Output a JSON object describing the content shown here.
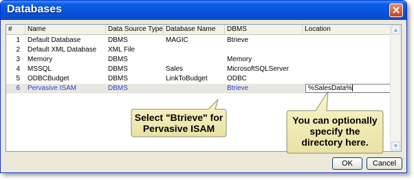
{
  "dialog": {
    "title": "Databases",
    "close_glyph": "✕"
  },
  "columns": [
    "#",
    "Name",
    "Data Source Type",
    "Database Name",
    "DBMS",
    "Location"
  ],
  "rows": [
    {
      "num": "1",
      "name": "Default Database",
      "type": "DBMS",
      "dbname": "MAGIC",
      "dbms": "Btrieve",
      "location": ""
    },
    {
      "num": "2",
      "name": "Default XML Database",
      "type": "XML File",
      "dbname": "",
      "dbms": "",
      "location": ""
    },
    {
      "num": "3",
      "name": "Memory",
      "type": "DBMS",
      "dbname": "",
      "dbms": "Memory",
      "location": ""
    },
    {
      "num": "4",
      "name": "MSSQL",
      "type": "DBMS",
      "dbname": "Sales",
      "dbms": "MicrosoftSQLServer",
      "location": ""
    },
    {
      "num": "5",
      "name": "ODBCBudget",
      "type": "DBMS",
      "dbname": "LinkToBudget",
      "dbms": "ODBC",
      "location": ""
    },
    {
      "num": "6",
      "name": "Pervasive ISAM",
      "type": "DBMS",
      "dbname": "",
      "dbms": "Btrieve",
      "location": "%SalesData%"
    }
  ],
  "callouts": {
    "dbms": "Select \"Btrieve\" for Pervasive ISAM",
    "location": "You can optionally specify the directory here."
  },
  "buttons": {
    "ok": "OK",
    "cancel": "Cancel"
  }
}
